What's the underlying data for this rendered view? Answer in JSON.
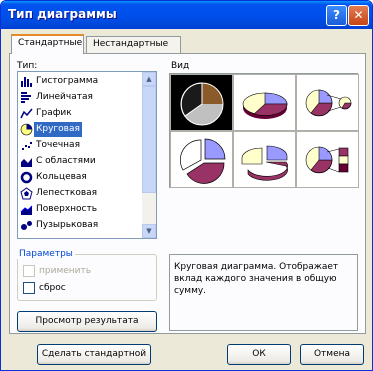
{
  "window": {
    "title": "Тип диаграммы",
    "help_label": "?",
    "close_label": "✕"
  },
  "tabs": [
    {
      "label": "Стандартные",
      "active": true
    },
    {
      "label": "Нестандартные",
      "active": false
    }
  ],
  "type_list": {
    "label": "Тип:",
    "items": [
      {
        "label": "Гистограмма",
        "icon": "column-chart-icon",
        "selected": false
      },
      {
        "label": "Линейчатая",
        "icon": "bar-chart-icon",
        "selected": false
      },
      {
        "label": "График",
        "icon": "line-chart-icon",
        "selected": false
      },
      {
        "label": "Круговая",
        "icon": "pie-chart-icon",
        "selected": true
      },
      {
        "label": "Точечная",
        "icon": "scatter-chart-icon",
        "selected": false
      },
      {
        "label": "С областями",
        "icon": "area-chart-icon",
        "selected": false
      },
      {
        "label": "Кольцевая",
        "icon": "doughnut-chart-icon",
        "selected": false
      },
      {
        "label": "Лепестковая",
        "icon": "radar-chart-icon",
        "selected": false
      },
      {
        "label": "Поверхность",
        "icon": "surface-chart-icon",
        "selected": false
      },
      {
        "label": "Пузырьковая",
        "icon": "bubble-chart-icon",
        "selected": false
      }
    ],
    "scroll_up": "▲",
    "scroll_down": "▼"
  },
  "params": {
    "title": "Параметры",
    "apply_label": "применить",
    "reset_label": "сброс"
  },
  "preview_button": "Просмотр результата",
  "view": {
    "label": "Вид",
    "selected_index": 0,
    "colors": {
      "blue": "#9999ff",
      "maroon": "#993366",
      "cream": "#ffffcc",
      "brown": "#8b5a2b",
      "gray": "#c0c0c0",
      "light": "#ccffcc"
    }
  },
  "description": "Круговая диаграмма. Отображает вклад каждого значения в общую сумму.",
  "footer": {
    "default_button": "Сделать стандартной",
    "ok_button": "ОК",
    "cancel_button": "Отмена"
  }
}
